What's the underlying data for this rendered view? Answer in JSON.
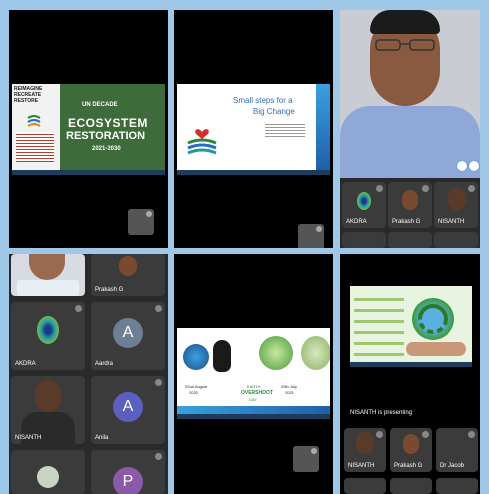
{
  "top_left": {
    "slide_left_text": "REIMAGINE RECREATE RESTORE",
    "slide_decade": "UN DECADE",
    "slide_title_line1": "ECOSYSTEM",
    "slide_title_line2": "RESTORATION",
    "slide_years": "2021-2030"
  },
  "top_middle": {
    "slide_title_line1": "Small steps for a",
    "slide_title_line2": "Big Change"
  },
  "top_right": {
    "participants": [
      {
        "name": "AKDRA"
      },
      {
        "name": "Prakash G"
      },
      {
        "name": "NISANTH"
      }
    ]
  },
  "bottom_left": {
    "participants": [
      {
        "name": "Prakash G"
      },
      {
        "name": "AKDRA"
      },
      {
        "name": "Aardra",
        "initial": "A",
        "color": "#6e7f95"
      },
      {
        "name": "NISANTH"
      },
      {
        "name": "Anila",
        "initial": "A",
        "color": "#5a5fc0"
      },
      {
        "initial": "P",
        "color": "#8a5aa8"
      }
    ]
  },
  "bottom_middle": {
    "slide_label1": "EARTH",
    "slide_label2": "OVERSHOOT",
    "slide_label3": "DAY",
    "date_left": "22nd August",
    "year_left": "2020",
    "date_right": "29th July",
    "year_right": "2021"
  },
  "bottom_right": {
    "status": "NISANTH is presenting",
    "participants": [
      {
        "name": "NISANTH"
      },
      {
        "name": "Prakash G"
      },
      {
        "name": "Dr Jacob"
      }
    ]
  }
}
